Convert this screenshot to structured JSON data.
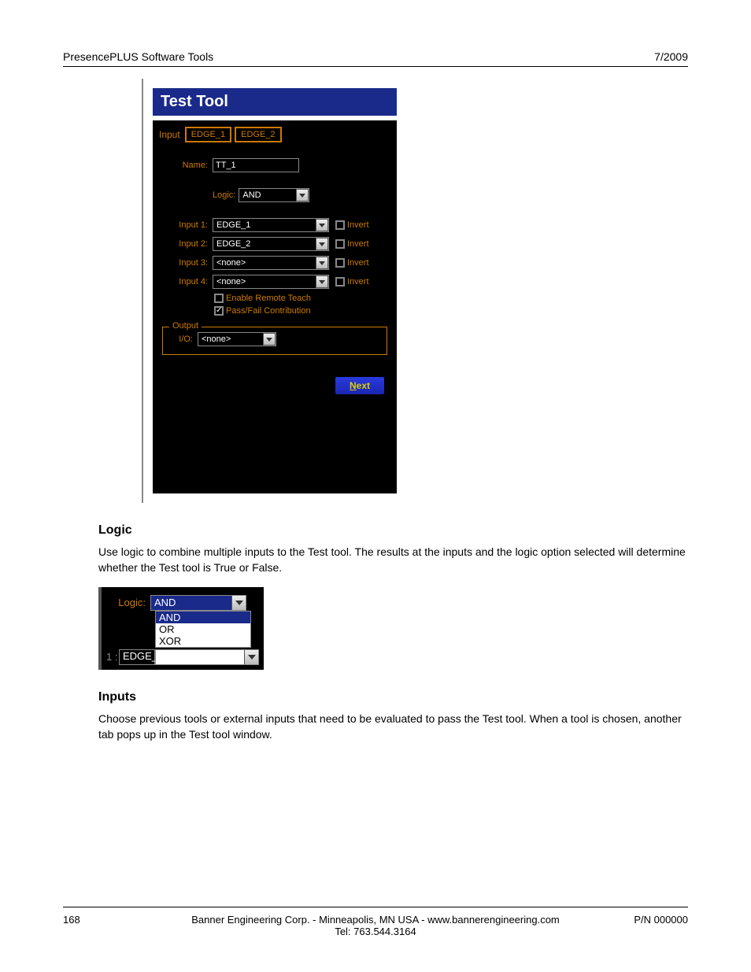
{
  "header": {
    "left": "PresencePLUS Software Tools",
    "right": "7/2009"
  },
  "app": {
    "title": "Test Tool",
    "tabs_label": "Input",
    "tabs": [
      "EDGE_1",
      "EDGE_2"
    ],
    "name_label": "Name:",
    "name_value": "TT_1",
    "logic_label": "Logic:",
    "logic_value": "AND",
    "inputs": [
      {
        "label": "Input 1:",
        "value": "EDGE_1",
        "invert_checked": false
      },
      {
        "label": "Input 2:",
        "value": "EDGE_2",
        "invert_checked": false
      },
      {
        "label": "Input 3:",
        "value": "<none>",
        "invert_checked": false
      },
      {
        "label": "Input 4:",
        "value": "<none>",
        "invert_checked": false
      }
    ],
    "invert_label": "Invert",
    "enable_remote_teach": {
      "label": "Enable Remote Teach",
      "checked": false
    },
    "passfail": {
      "label": "Pass/Fail Contribution",
      "checked": true
    },
    "output": {
      "legend": "Output",
      "io_label": "I/O:",
      "io_value": "<none>"
    },
    "next_prefix": "N",
    "next_suffix": "ext"
  },
  "section_logic": {
    "heading": "Logic",
    "text": "Use logic to combine multiple inputs to the Test tool. The results at the inputs and the logic option selected will determine whether the Test tool is True or False."
  },
  "logic_dropdown": {
    "label": "Logic:",
    "value": "AND",
    "options": [
      "AND",
      "OR",
      "XOR"
    ],
    "row2": {
      "idx": "1 :",
      "text": "EDGE_"
    }
  },
  "section_inputs": {
    "heading": "Inputs",
    "text": "Choose previous tools or external inputs that need to be evaluated to pass the Test tool. When a tool is chosen, another tab pops up in the Test tool window."
  },
  "footer": {
    "page_num": "168",
    "center_line1": "Banner Engineering Corp. - Minneapolis, MN USA - www.bannerengineering.com",
    "center_line2": "Tel: 763.544.3164",
    "part_num": "P/N 000000"
  }
}
